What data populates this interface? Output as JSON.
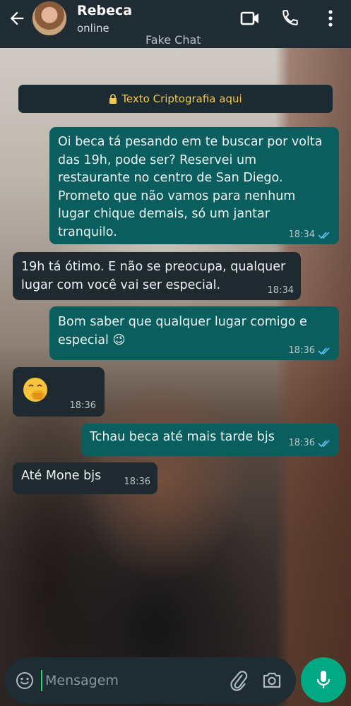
{
  "header": {
    "contact_name": "Rebeca",
    "status": "online",
    "watermark": "Fake Chat",
    "icons": [
      "back-arrow-icon",
      "video-call-icon",
      "phone-icon",
      "more-options-icon"
    ]
  },
  "encryption_notice": "Texto Criptografia aqui",
  "messages": [
    {
      "direction": "outgoing",
      "text": "Oi beca tá pesando em te buscar por volta das 19h, pode ser? Reservei um restaurante no centro de San Diego. Prometo que não vamos para nenhum lugar chique demais, só um jantar tranquilo.",
      "time": "18:34",
      "read": true
    },
    {
      "direction": "incoming",
      "text": "19h tá ótimo. E não se preocupa, qualquer lugar com você vai ser especial.",
      "time": "18:34"
    },
    {
      "direction": "outgoing",
      "text": "Bom saber que qualquer lugar comigo e especial 😉",
      "time": "18:36",
      "read": true
    },
    {
      "direction": "incoming",
      "text": "🤭",
      "time": "18:36"
    },
    {
      "direction": "outgoing",
      "text": "Tchau beca até mais tarde bjs",
      "time": "18:36",
      "read": true
    },
    {
      "direction": "incoming",
      "text": "Até Mone bjs",
      "time": "18:36"
    }
  ],
  "composer": {
    "placeholder": "Mensagem",
    "icons": [
      "emoji-icon",
      "attach-icon",
      "camera-icon",
      "microphone-icon"
    ]
  },
  "colors": {
    "header_bg": "#1f2c33",
    "outgoing_bubble": "#0b5e5e",
    "incoming_bubble": "#1e2a30",
    "read_ticks": "#53bdeb",
    "mic_button": "#00a884",
    "encryption_text": "#f2c94c"
  }
}
